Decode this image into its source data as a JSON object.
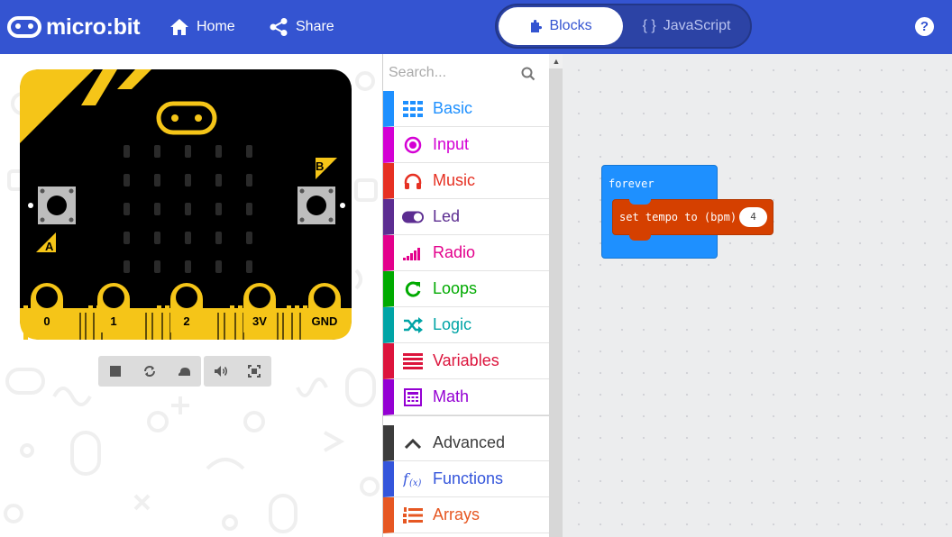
{
  "header": {
    "logo_text": "micro:bit",
    "home_label": "Home",
    "share_label": "Share",
    "blocks_tab_label": "Blocks",
    "js_tab_label": "JavaScript",
    "js_tab_glyph": "{ }",
    "help_glyph": "?",
    "colors": {
      "bar": "#3454d1"
    }
  },
  "simulator": {
    "board_color": "#000000",
    "accent_color": "#f5c518",
    "button_a": "A",
    "button_b": "B",
    "pins": [
      "0",
      "1",
      "2",
      "3V",
      "GND"
    ],
    "controls": [
      "stop-icon",
      "restart-icon",
      "slowmo-icon",
      "sound-icon",
      "fullscreen-icon"
    ]
  },
  "toolbox": {
    "search_placeholder": "Search...",
    "categories": [
      {
        "label": "Basic",
        "color": "#1e90ff",
        "icon": "grid-icon"
      },
      {
        "label": "Input",
        "color": "#d400d4",
        "icon": "input-circle-icon"
      },
      {
        "label": "Music",
        "color": "#e63022",
        "icon": "headphones-icon"
      },
      {
        "label": "Led",
        "color": "#5c2d91",
        "icon": "toggle-icon"
      },
      {
        "label": "Radio",
        "color": "#e3008c",
        "icon": "signal-bars-icon"
      },
      {
        "label": "Loops",
        "color": "#00aa00",
        "icon": "refresh-icon"
      },
      {
        "label": "Logic",
        "color": "#00a4a6",
        "icon": "shuffle-icon"
      },
      {
        "label": "Variables",
        "color": "#dc143c",
        "icon": "list-lines-icon"
      },
      {
        "label": "Math",
        "color": "#9400d3",
        "icon": "calculator-icon"
      },
      {
        "label": "Advanced",
        "color": "#3c3c3c",
        "icon": "chevron-up-icon"
      },
      {
        "label": "Functions",
        "color": "#3455db",
        "icon": "function-icon"
      },
      {
        "label": "Arrays",
        "color": "#e65722",
        "icon": "numbered-list-icon"
      }
    ]
  },
  "workspace": {
    "forever_label": "forever",
    "tempo_label": "set tempo to (bpm)",
    "tempo_value": "4"
  }
}
